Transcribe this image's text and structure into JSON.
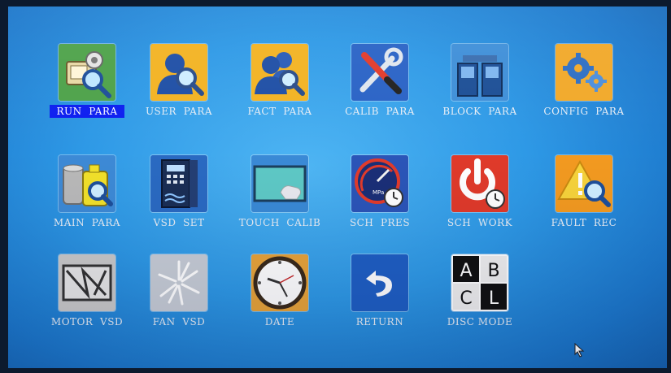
{
  "menu": {
    "items": [
      {
        "label": "RUN  PARA",
        "icon": "run-para-icon",
        "selected": true
      },
      {
        "label": "USER  PARA",
        "icon": "user-para-icon"
      },
      {
        "label": "FACT  PARA",
        "icon": "fact-para-icon"
      },
      {
        "label": "CALIB  PARA",
        "icon": "calib-para-icon"
      },
      {
        "label": "BLOCK  PARA",
        "icon": "block-para-icon"
      },
      {
        "label": "CONFIG  PARA",
        "icon": "config-para-icon"
      },
      {
        "label": "MAIN  PARA",
        "icon": "main-para-icon"
      },
      {
        "label": "VSD  SET",
        "icon": "vsd-set-icon"
      },
      {
        "label": "TOUCH  CALIB",
        "icon": "touch-calib-icon"
      },
      {
        "label": "SCH  PRES",
        "icon": "sch-pres-icon"
      },
      {
        "label": "SCH  WORK",
        "icon": "sch-work-icon"
      },
      {
        "label": "FAULT  REC",
        "icon": "fault-rec-icon"
      },
      {
        "label": "MOTOR  VSD",
        "icon": "motor-vsd-icon"
      },
      {
        "label": "FAN  VSD",
        "icon": "fan-vsd-icon"
      },
      {
        "label": "DATE",
        "icon": "clock-icon"
      },
      {
        "label": "RETURN",
        "icon": "return-arrow-icon"
      },
      {
        "label": "DISC MODE",
        "icon": "abcl-icon"
      }
    ]
  },
  "icon_text": {
    "pressure_unit": "MPa",
    "abcl": [
      "A",
      "B",
      "C",
      "L"
    ]
  },
  "colors": {
    "selection": "#0d1ef0",
    "background": "#2e99e6",
    "label": "#e9eef5"
  }
}
